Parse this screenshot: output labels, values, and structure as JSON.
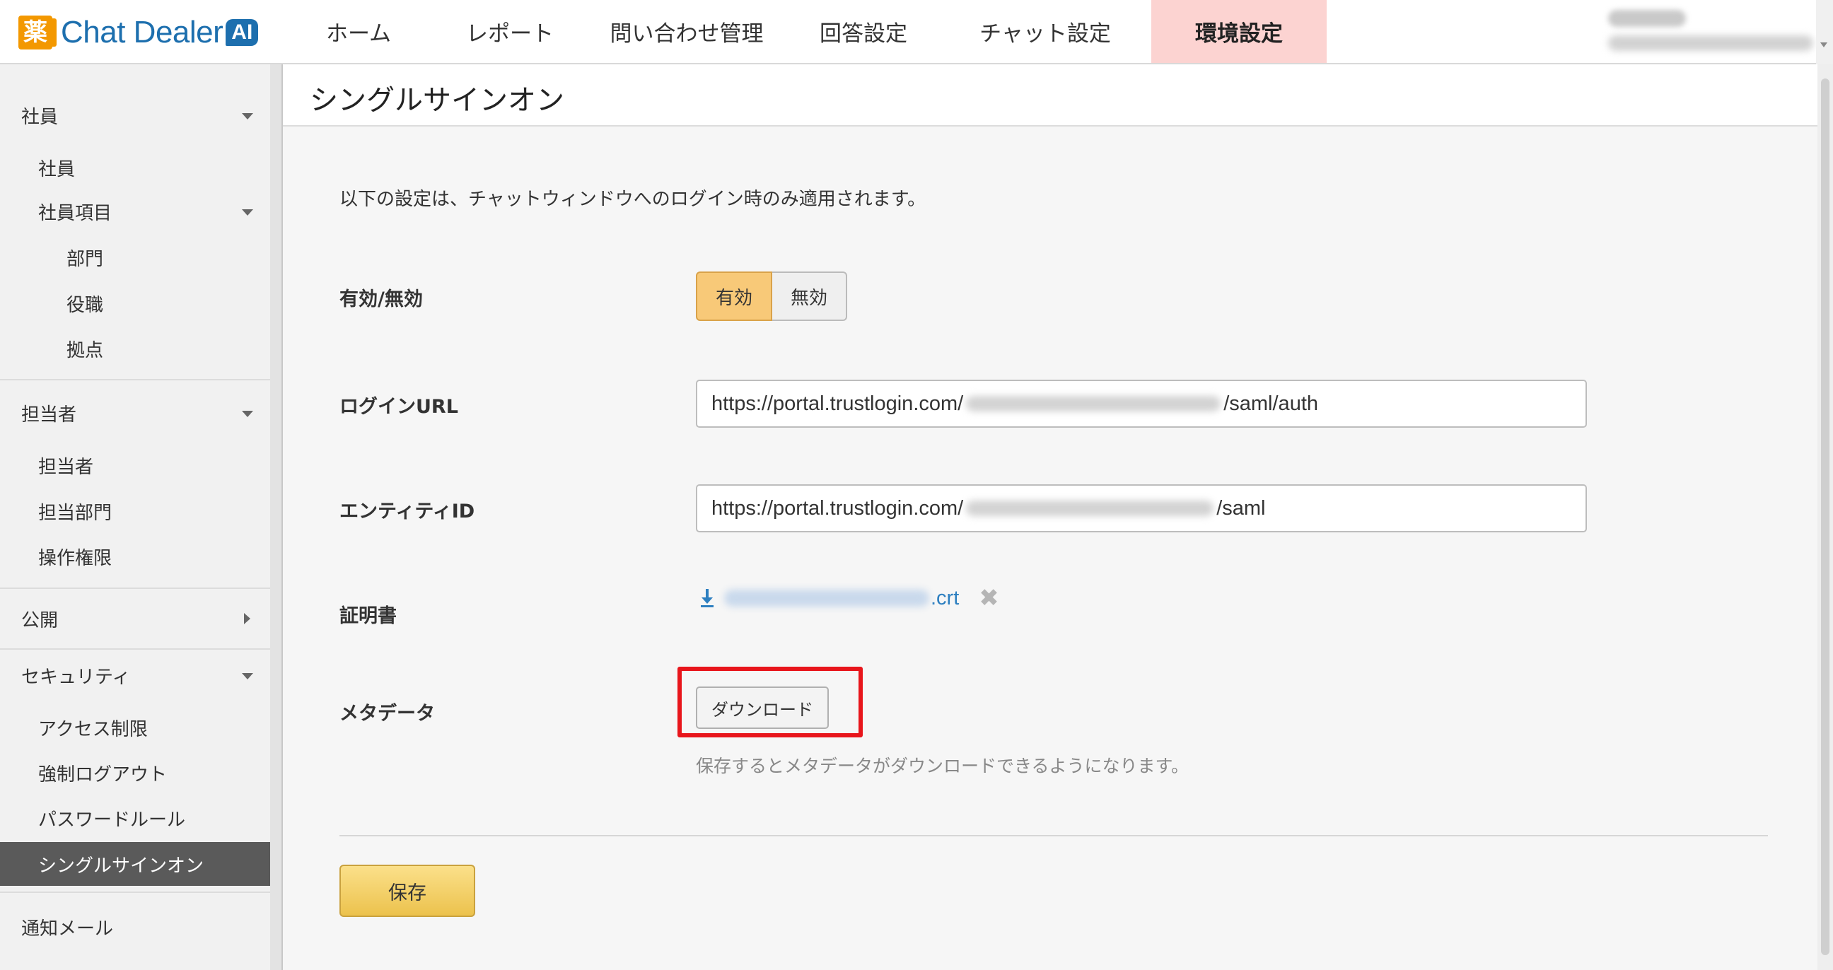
{
  "app": {
    "logo_mark": "薬",
    "logo_text": "Chat Dealer",
    "logo_badge": "AI"
  },
  "nav": {
    "items": [
      {
        "label": "ホーム"
      },
      {
        "label": "レポート"
      },
      {
        "label": "問い合わせ管理"
      },
      {
        "label": "回答設定"
      },
      {
        "label": "チャット設定"
      },
      {
        "label": "環境設定",
        "active": true
      }
    ]
  },
  "sidebar": {
    "shain": "社員",
    "shain_sub": "社員",
    "shain_items": "社員項目",
    "bumon": "部門",
    "yakushoku": "役職",
    "kyoten": "拠点",
    "tantousha": "担当者",
    "tantousha_sub": "担当者",
    "tantou_bumon": "担当部門",
    "sousa_kengen": "操作権限",
    "koukai": "公開",
    "security": "セキュリティ",
    "access": "アクセス制限",
    "logout": "強制ログアウト",
    "password": "パスワードルール",
    "sso": "シングルサインオン",
    "mail": "通知メール"
  },
  "page": {
    "title": "シングルサインオン",
    "description": "以下の設定は、チャットウィンドウへのログイン時のみ適用されます。"
  },
  "form": {
    "enable_label": "有効/無効",
    "enable_on": "有効",
    "enable_off": "無効",
    "enabled": true,
    "login_url_label": "ログインURL",
    "login_url_prefix": "https://portal.trustlogin.com/",
    "login_url_suffix": "/saml/auth",
    "entity_id_label": "エンティティID",
    "entity_id_prefix": "https://portal.trustlogin.com/",
    "entity_id_suffix": "/saml",
    "cert_label": "証明書",
    "cert_ext": ".crt",
    "cert_remove": "✖",
    "metadata_label": "メタデータ",
    "download_button": "ダウンロード",
    "metadata_help": "保存するとメタデータがダウンロードできるようになります。",
    "save_button": "保存"
  },
  "colors": {
    "brand_blue": "#1d6fae",
    "brand_orange": "#f39800",
    "active_tab_bg": "#fcd3d1",
    "toggle_on": "#f8c978",
    "highlight_red": "#e8151b",
    "link_blue": "#2d7fc0"
  }
}
